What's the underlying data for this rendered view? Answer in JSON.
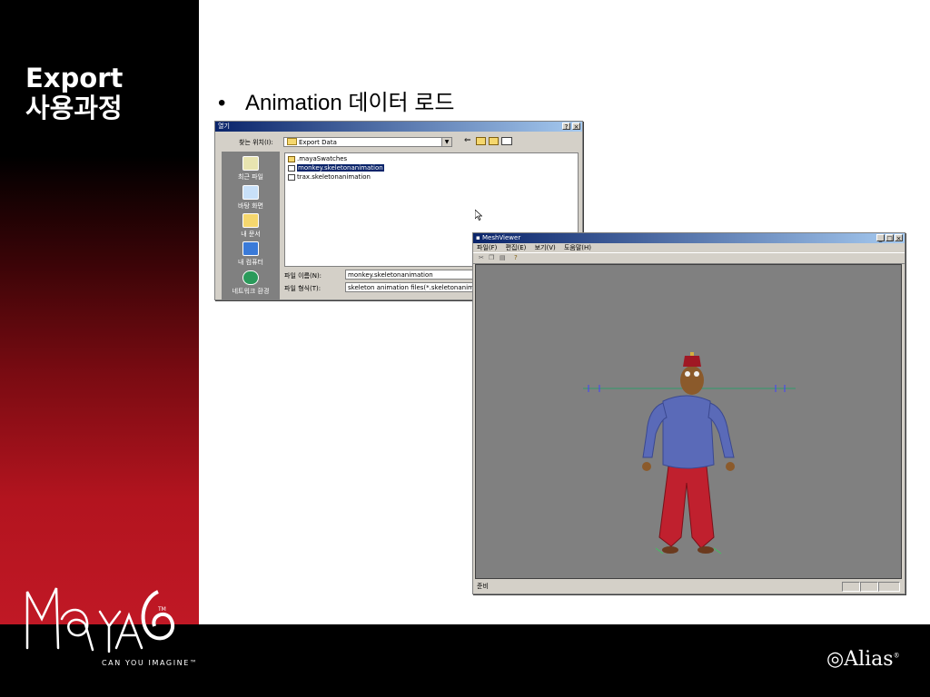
{
  "slide": {
    "title_line1": "Export",
    "title_line2": "사용과정",
    "bullet_symbol": "•",
    "bullet_text": "Animation 데이터 로드"
  },
  "branding": {
    "maya_logo": "MAYA 6",
    "maya_tagline": "CAN YOU IMAGINE™",
    "alias_logo": "Alias"
  },
  "open_dialog": {
    "title": "열기",
    "help_btn": "?",
    "close_btn": "×",
    "look_in_label": "찾는 위치(I):",
    "look_in_value": "Export Data",
    "places": [
      {
        "label": "최근 파일",
        "icon": "recent-files-icon"
      },
      {
        "label": "바탕 화면",
        "icon": "desktop-icon"
      },
      {
        "label": "내 문서",
        "icon": "my-documents-icon"
      },
      {
        "label": "내 컴퓨터",
        "icon": "my-computer-icon"
      },
      {
        "label": "네트워크 환경",
        "icon": "network-icon"
      }
    ],
    "files": [
      {
        "name": ".mayaSwatches",
        "type": "folder",
        "selected": false
      },
      {
        "name": "monkey.skeletonanimation",
        "type": "file",
        "selected": true
      },
      {
        "name": "trax.skeletonanimation",
        "type": "file",
        "selected": false
      }
    ],
    "filename_label": "파일 이름(N):",
    "filename_value": "monkey.skeletonanimation",
    "filetype_label": "파일 형식(T):",
    "filetype_value": "skeleton animation files(*.skeletonanimation)"
  },
  "mesh_viewer": {
    "title": "MeshViewer",
    "menu": [
      "파일(F)",
      "편집(E)",
      "보기(V)",
      "도움말(H)"
    ],
    "toolbar": [
      "cut-icon",
      "copy-icon",
      "paste-icon",
      "help-icon"
    ],
    "status": "준비"
  },
  "colors": {
    "title_bar": "#0a246a",
    "selection": "#0a246a",
    "viewport_bg": "#808080",
    "panel_red": "#c01825"
  }
}
